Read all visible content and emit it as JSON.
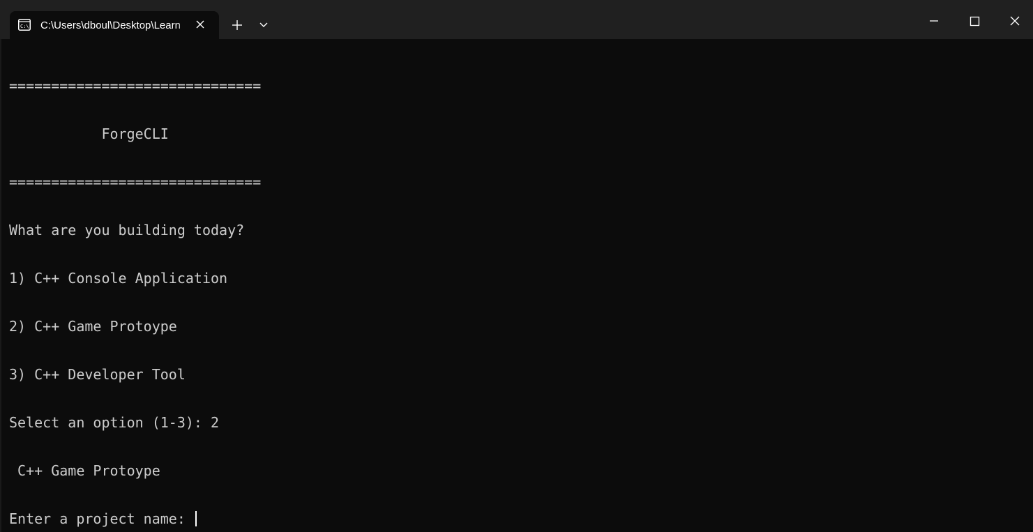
{
  "tab": {
    "title": "C:\\Users\\dboul\\Desktop\\Learn",
    "icon": "terminal-icon"
  },
  "titlebar": {
    "new_tab_icon": "plus-icon",
    "dropdown_icon": "chevron-down-icon",
    "minimize_icon": "minimize-icon",
    "maximize_icon": "maximize-icon",
    "close_icon": "close-icon"
  },
  "colors": {
    "background": "#0c0c0c",
    "titlebar": "#202020",
    "text": "#cccccc",
    "accent": "#c9a227"
  },
  "terminal": {
    "lines": [
      "==============================",
      "           ForgeCLI",
      "==============================",
      "What are you building today?",
      "1) C++ Console Application",
      "2) C++ Game Protoype",
      "3) C++ Developer Tool",
      "Select an option (1-3): 2",
      " C++ Game Protoype"
    ],
    "prompt": "Enter a project name: ",
    "input_value": ""
  }
}
